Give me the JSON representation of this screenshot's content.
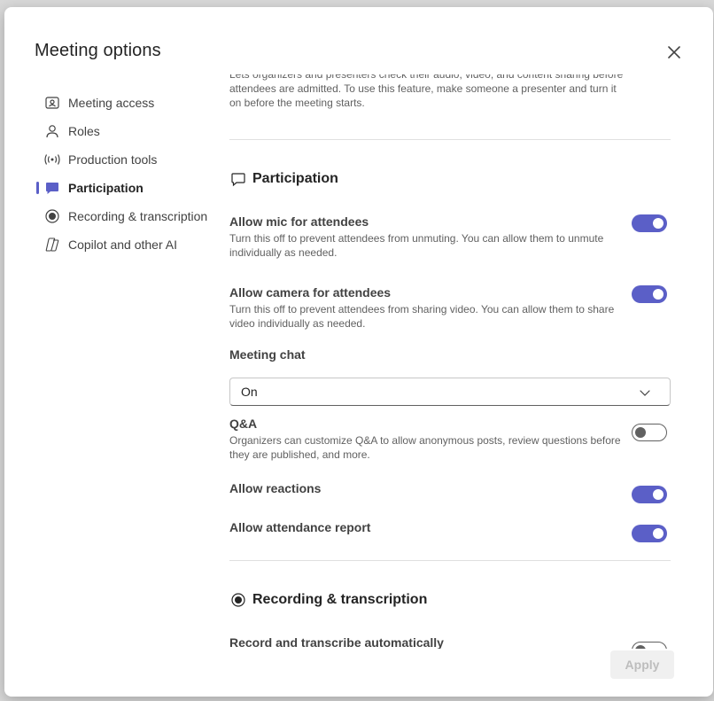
{
  "dialog": {
    "title": "Meeting options",
    "apply_label": "Apply"
  },
  "nav": {
    "items": [
      {
        "label": "Meeting access",
        "icon": "meeting-access-icon"
      },
      {
        "label": "Roles",
        "icon": "person-icon"
      },
      {
        "label": "Production tools",
        "icon": "broadcast-icon"
      },
      {
        "label": "Participation",
        "icon": "chat-bubble-icon",
        "active": true
      },
      {
        "label": "Recording & transcription",
        "icon": "record-icon"
      },
      {
        "label": "Copilot and other AI",
        "icon": "copilot-icon"
      }
    ]
  },
  "content": {
    "top_description": "Lets organizers and presenters check their audio, video, and content sharing before attendees are admitted. To use this feature, make someone a presenter and turn it on before the meeting starts.",
    "participation": {
      "heading": "Participation",
      "mic": {
        "label": "Allow mic for attendees",
        "desc": "Turn this off to prevent attendees from unmuting. You can allow them to unmute individually as needed.",
        "on": true
      },
      "camera": {
        "label": "Allow camera for attendees",
        "desc": "Turn this off to prevent attendees from sharing video. You can allow them to share video individually as needed.",
        "on": true
      },
      "chat": {
        "label": "Meeting chat",
        "value": "On"
      },
      "qa": {
        "label": "Q&A",
        "desc": "Organizers can customize Q&A to allow anonymous posts, review questions before they are published, and more.",
        "on": false
      },
      "reactions": {
        "label": "Allow reactions",
        "on": true
      },
      "attendance": {
        "label": "Allow attendance report",
        "on": true
      }
    },
    "recording": {
      "heading": "Recording & transcription",
      "auto": {
        "label": "Record and transcribe automatically",
        "on": false
      }
    }
  },
  "colors": {
    "accent": "#5b5fc7",
    "text": "#242424",
    "muted": "#616161"
  }
}
